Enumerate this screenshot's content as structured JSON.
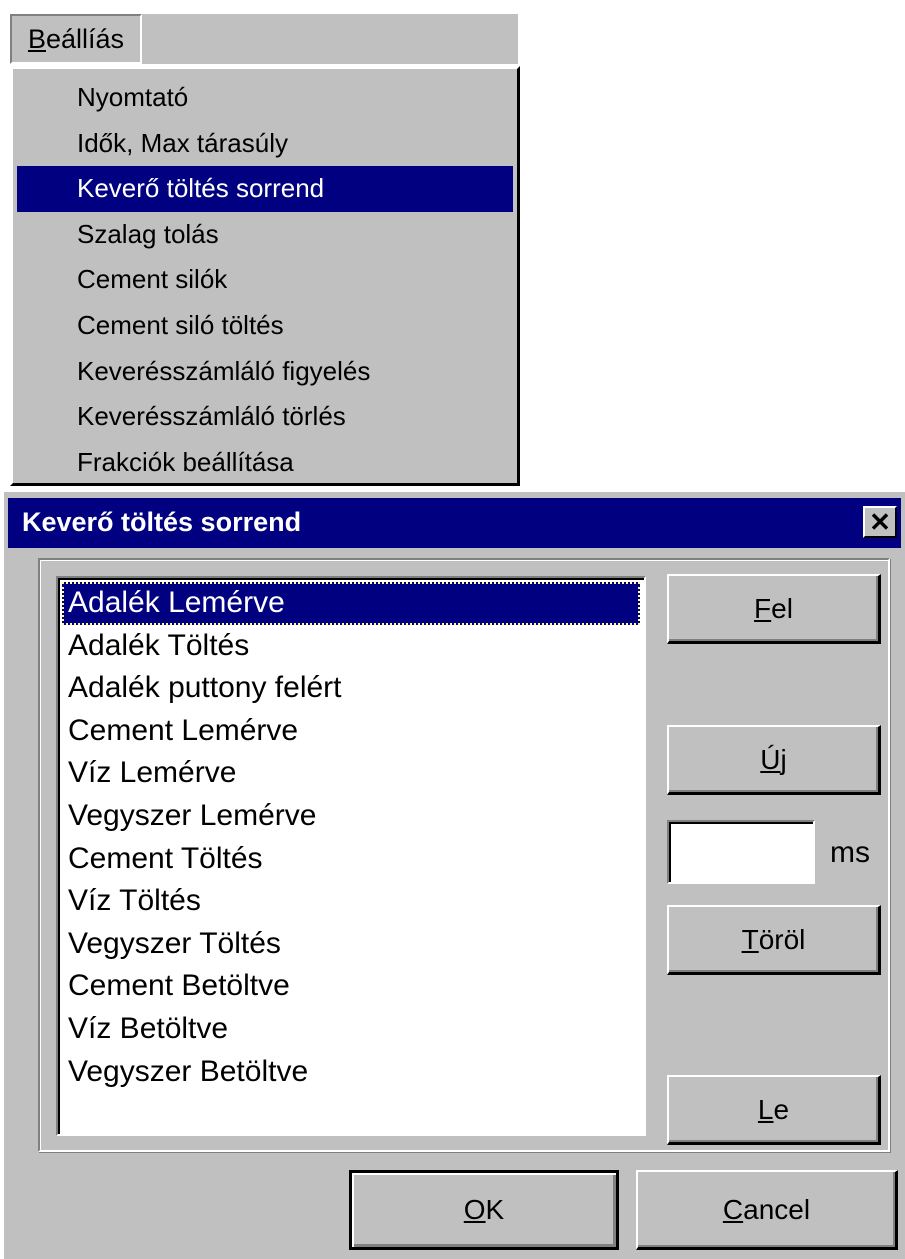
{
  "menubar": {
    "title_hotkey": "B",
    "title_rest": "eállíás"
  },
  "menu": {
    "items": [
      {
        "label": "Nyomtató"
      },
      {
        "label": "Idők, Max tárasúly"
      },
      {
        "label": "Keverő töltés sorrend",
        "selected": true
      },
      {
        "label": "Szalag tolás"
      },
      {
        "label": "Cement silók"
      },
      {
        "label": "Cement siló töltés"
      },
      {
        "label": "Keverésszámláló figyelés"
      },
      {
        "label": "Keverésszámláló törlés"
      },
      {
        "label": "Frakciók beállítása"
      }
    ]
  },
  "dialog": {
    "title": "Keverő töltés sorrend",
    "close_glyph": "✕",
    "list": {
      "items": [
        "Adalék Lemérve",
        "Adalék Töltés",
        "Adalék puttony felért",
        "Cement Lemérve",
        "Víz Lemérve",
        "Vegyszer Lemérve",
        "Cement Töltés",
        "Víz Töltés",
        "Vegyszer Töltés",
        "Cement Betöltve",
        "Víz Betöltve",
        "Vegyszer Betöltve"
      ],
      "selected_index": 0
    },
    "buttons": {
      "fel_hotkey": "F",
      "fel_rest": "el",
      "uj_hotkey": "Ú",
      "uj_rest": "j",
      "torol_hotkey": "T",
      "torol_rest": "öröl",
      "le_hotkey": "L",
      "le_rest": "e",
      "ok_hotkey": "O",
      "ok_rest": "K",
      "cancel_hotkey": "C",
      "cancel_rest": "ancel"
    },
    "ms_input": {
      "value": ""
    },
    "ms_label": "ms"
  },
  "colors": {
    "face": "#c0c0c0",
    "selection": "#000080",
    "titlebar": "#000080"
  }
}
